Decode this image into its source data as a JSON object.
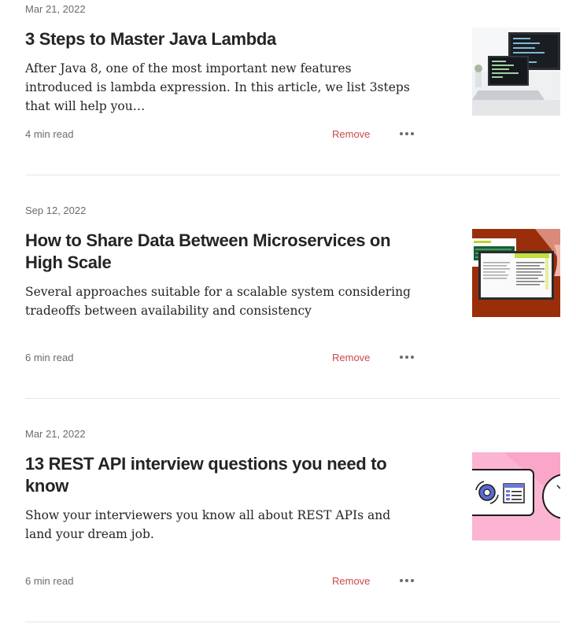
{
  "articles": [
    {
      "date": "Mar 21, 2022",
      "title": "3 Steps to Master Java Lambda",
      "excerpt": "After Java 8, one of the most important new features introduced is lambda expression. In this article, we list 3steps that will help you…",
      "read_time": "4 min read",
      "remove_label": "Remove",
      "thumbnail_icon": "laptop-code-photo"
    },
    {
      "date": "Sep 12, 2022",
      "title": "How to Share Data Between Microservices on High Scale",
      "excerpt": "Several approaches suitable for a scalable system considering tradeoffs between availability and consistency",
      "read_time": "6 min read",
      "remove_label": "Remove",
      "thumbnail_icon": "documents-illustration"
    },
    {
      "date": "Mar 21, 2022",
      "title": "13 REST API interview questions you need to know",
      "excerpt": "Show your interviewers you know all about REST APIs and land your dream job.",
      "read_time": "6 min read",
      "remove_label": "Remove",
      "thumbnail_icon": "rest-api-illustration"
    }
  ],
  "colors": {
    "remove": "#c94a4a",
    "meta": "#6b6b6b",
    "divider": "#e6e6e6"
  }
}
